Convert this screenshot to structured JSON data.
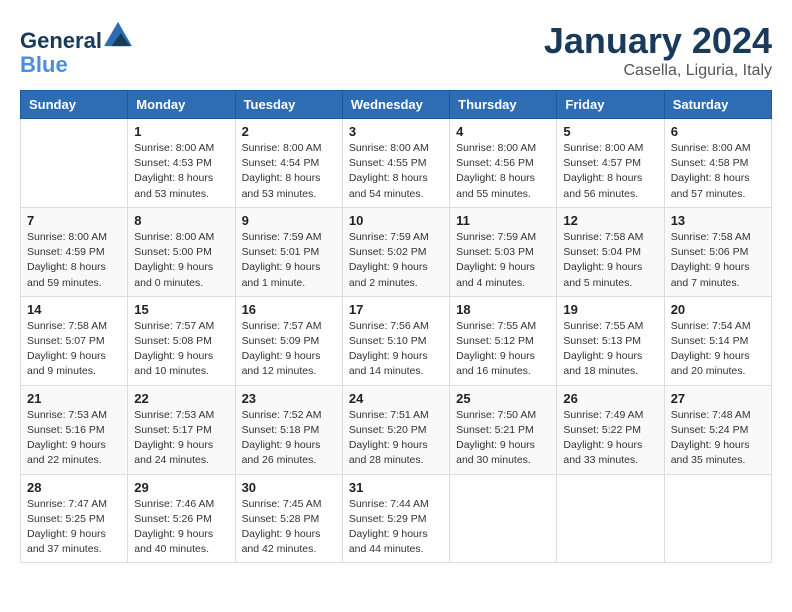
{
  "header": {
    "logo_line1": "General",
    "logo_line2": "Blue",
    "title": "January 2024",
    "subtitle": "Casella, Liguria, Italy"
  },
  "columns": [
    "Sunday",
    "Monday",
    "Tuesday",
    "Wednesday",
    "Thursday",
    "Friday",
    "Saturday"
  ],
  "weeks": [
    [
      {
        "day": "",
        "info": ""
      },
      {
        "day": "1",
        "info": "Sunrise: 8:00 AM\nSunset: 4:53 PM\nDaylight: 8 hours\nand 53 minutes."
      },
      {
        "day": "2",
        "info": "Sunrise: 8:00 AM\nSunset: 4:54 PM\nDaylight: 8 hours\nand 53 minutes."
      },
      {
        "day": "3",
        "info": "Sunrise: 8:00 AM\nSunset: 4:55 PM\nDaylight: 8 hours\nand 54 minutes."
      },
      {
        "day": "4",
        "info": "Sunrise: 8:00 AM\nSunset: 4:56 PM\nDaylight: 8 hours\nand 55 minutes."
      },
      {
        "day": "5",
        "info": "Sunrise: 8:00 AM\nSunset: 4:57 PM\nDaylight: 8 hours\nand 56 minutes."
      },
      {
        "day": "6",
        "info": "Sunrise: 8:00 AM\nSunset: 4:58 PM\nDaylight: 8 hours\nand 57 minutes."
      }
    ],
    [
      {
        "day": "7",
        "info": "Sunrise: 8:00 AM\nSunset: 4:59 PM\nDaylight: 8 hours\nand 59 minutes."
      },
      {
        "day": "8",
        "info": "Sunrise: 8:00 AM\nSunset: 5:00 PM\nDaylight: 9 hours\nand 0 minutes."
      },
      {
        "day": "9",
        "info": "Sunrise: 7:59 AM\nSunset: 5:01 PM\nDaylight: 9 hours\nand 1 minute."
      },
      {
        "day": "10",
        "info": "Sunrise: 7:59 AM\nSunset: 5:02 PM\nDaylight: 9 hours\nand 2 minutes."
      },
      {
        "day": "11",
        "info": "Sunrise: 7:59 AM\nSunset: 5:03 PM\nDaylight: 9 hours\nand 4 minutes."
      },
      {
        "day": "12",
        "info": "Sunrise: 7:58 AM\nSunset: 5:04 PM\nDaylight: 9 hours\nand 5 minutes."
      },
      {
        "day": "13",
        "info": "Sunrise: 7:58 AM\nSunset: 5:06 PM\nDaylight: 9 hours\nand 7 minutes."
      }
    ],
    [
      {
        "day": "14",
        "info": "Sunrise: 7:58 AM\nSunset: 5:07 PM\nDaylight: 9 hours\nand 9 minutes."
      },
      {
        "day": "15",
        "info": "Sunrise: 7:57 AM\nSunset: 5:08 PM\nDaylight: 9 hours\nand 10 minutes."
      },
      {
        "day": "16",
        "info": "Sunrise: 7:57 AM\nSunset: 5:09 PM\nDaylight: 9 hours\nand 12 minutes."
      },
      {
        "day": "17",
        "info": "Sunrise: 7:56 AM\nSunset: 5:10 PM\nDaylight: 9 hours\nand 14 minutes."
      },
      {
        "day": "18",
        "info": "Sunrise: 7:55 AM\nSunset: 5:12 PM\nDaylight: 9 hours\nand 16 minutes."
      },
      {
        "day": "19",
        "info": "Sunrise: 7:55 AM\nSunset: 5:13 PM\nDaylight: 9 hours\nand 18 minutes."
      },
      {
        "day": "20",
        "info": "Sunrise: 7:54 AM\nSunset: 5:14 PM\nDaylight: 9 hours\nand 20 minutes."
      }
    ],
    [
      {
        "day": "21",
        "info": "Sunrise: 7:53 AM\nSunset: 5:16 PM\nDaylight: 9 hours\nand 22 minutes."
      },
      {
        "day": "22",
        "info": "Sunrise: 7:53 AM\nSunset: 5:17 PM\nDaylight: 9 hours\nand 24 minutes."
      },
      {
        "day": "23",
        "info": "Sunrise: 7:52 AM\nSunset: 5:18 PM\nDaylight: 9 hours\nand 26 minutes."
      },
      {
        "day": "24",
        "info": "Sunrise: 7:51 AM\nSunset: 5:20 PM\nDaylight: 9 hours\nand 28 minutes."
      },
      {
        "day": "25",
        "info": "Sunrise: 7:50 AM\nSunset: 5:21 PM\nDaylight: 9 hours\nand 30 minutes."
      },
      {
        "day": "26",
        "info": "Sunrise: 7:49 AM\nSunset: 5:22 PM\nDaylight: 9 hours\nand 33 minutes."
      },
      {
        "day": "27",
        "info": "Sunrise: 7:48 AM\nSunset: 5:24 PM\nDaylight: 9 hours\nand 35 minutes."
      }
    ],
    [
      {
        "day": "28",
        "info": "Sunrise: 7:47 AM\nSunset: 5:25 PM\nDaylight: 9 hours\nand 37 minutes."
      },
      {
        "day": "29",
        "info": "Sunrise: 7:46 AM\nSunset: 5:26 PM\nDaylight: 9 hours\nand 40 minutes."
      },
      {
        "day": "30",
        "info": "Sunrise: 7:45 AM\nSunset: 5:28 PM\nDaylight: 9 hours\nand 42 minutes."
      },
      {
        "day": "31",
        "info": "Sunrise: 7:44 AM\nSunset: 5:29 PM\nDaylight: 9 hours\nand 44 minutes."
      },
      {
        "day": "",
        "info": ""
      },
      {
        "day": "",
        "info": ""
      },
      {
        "day": "",
        "info": ""
      }
    ]
  ]
}
